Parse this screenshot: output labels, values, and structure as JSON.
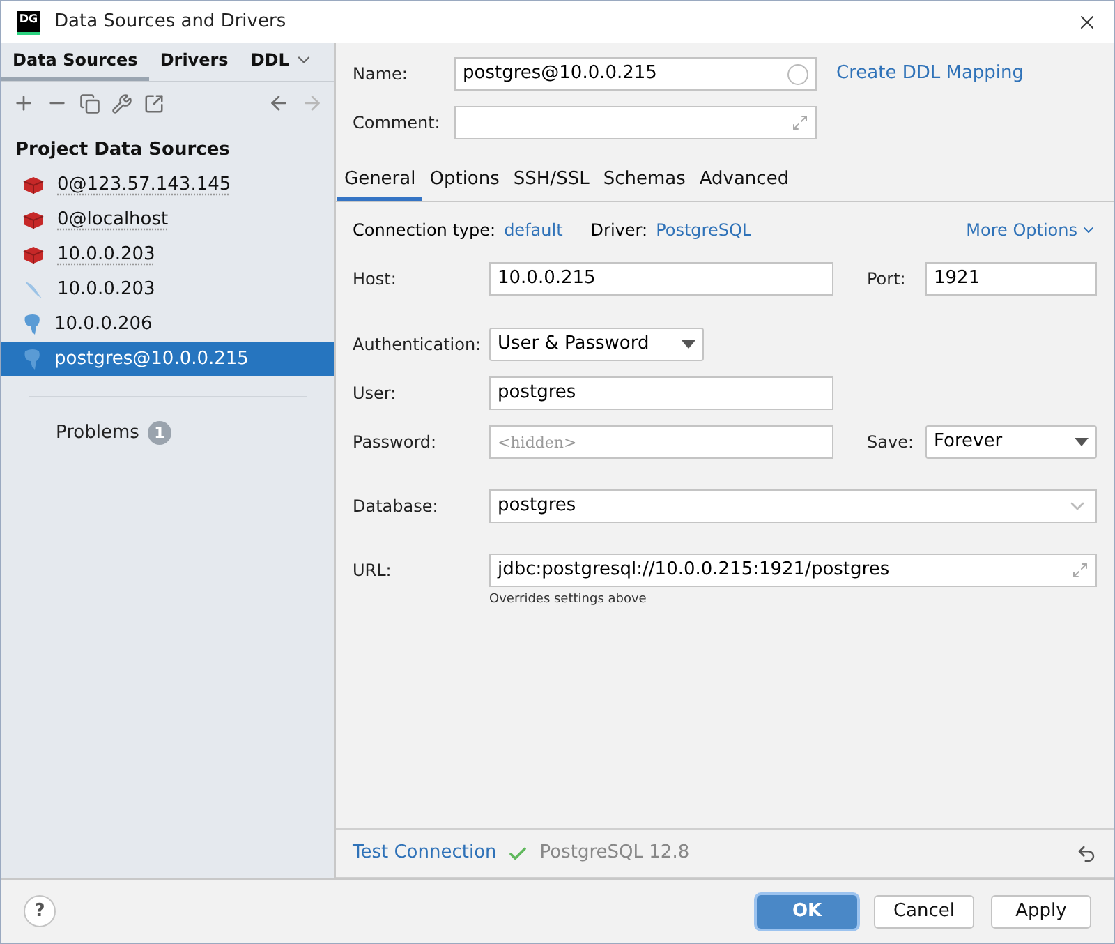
{
  "window": {
    "logo": "DG",
    "title": "Data Sources and Drivers"
  },
  "left_tabs": [
    {
      "label": "Data Sources",
      "selected": true
    },
    {
      "label": "Drivers",
      "selected": false
    },
    {
      "label": "DDL",
      "selected": false
    }
  ],
  "sidebar": {
    "heading": "Project Data Sources",
    "items": [
      {
        "label": "0@123.57.143.145",
        "kind": "redis",
        "underlined": true,
        "selected": false
      },
      {
        "label": "0@localhost",
        "kind": "redis",
        "underlined": true,
        "selected": false
      },
      {
        "label": "10.0.0.203",
        "kind": "redis",
        "underlined": true,
        "selected": false
      },
      {
        "label": "10.0.0.203",
        "kind": "mysql",
        "underlined": false,
        "selected": false
      },
      {
        "label": "10.0.0.206",
        "kind": "postgres",
        "underlined": false,
        "selected": false
      },
      {
        "label": "postgres@10.0.0.215",
        "kind": "postgres",
        "underlined": false,
        "selected": true
      }
    ],
    "problems": {
      "label": "Problems",
      "count": "1"
    }
  },
  "name": {
    "label": "Name:",
    "value": "postgres@10.0.0.215",
    "link": "Create DDL Mapping"
  },
  "comment": {
    "label": "Comment:"
  },
  "tabs": [
    {
      "label": "General",
      "selected": true
    },
    {
      "label": "Options",
      "selected": false
    },
    {
      "label": "SSH/SSL",
      "selected": false
    },
    {
      "label": "Schemas",
      "selected": false
    },
    {
      "label": "Advanced",
      "selected": false
    }
  ],
  "connection": {
    "type_label": "Connection type:",
    "type": "default",
    "driver_label": "Driver:",
    "driver": "PostgreSQL",
    "more": "More Options"
  },
  "host": {
    "label": "Host:",
    "value": "10.0.0.215",
    "port_label": "Port:",
    "port": "1921"
  },
  "authentication": {
    "label": "Authentication:",
    "value": "User & Password"
  },
  "user": {
    "label": "User:",
    "value": "postgres"
  },
  "password": {
    "label": "Password:",
    "placeholder": "<hidden>",
    "save_label": "Save:",
    "save": "Forever"
  },
  "database": {
    "label": "Database:",
    "value": "postgres"
  },
  "url": {
    "label": "URL:",
    "value": "jdbc:postgresql://10.0.0.215:1921/postgres",
    "hint": "Overrides settings above"
  },
  "test": {
    "link": "Test Connection",
    "result": "PostgreSQL 12.8"
  },
  "help": "?",
  "buttons": [
    {
      "label": "OK",
      "primary": true
    },
    {
      "label": "Cancel",
      "primary": false
    },
    {
      "label": "Apply",
      "primary": false
    }
  ]
}
